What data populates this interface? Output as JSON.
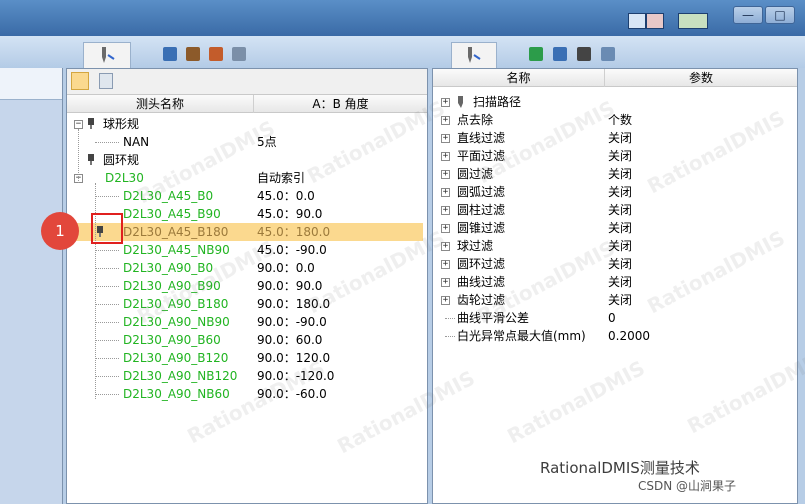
{
  "window": {
    "min_label": "—",
    "max_label": "□",
    "close_label": "✕"
  },
  "toolstrip": {
    "left_tab_icons": [
      "probe-tab-icon",
      "cube-icon",
      "probe-icon",
      "chart-icon",
      "report-icon"
    ],
    "right_tab_icons": [
      "probe-tab-icon",
      "axes-icon",
      "export-icon",
      "camera-icon",
      "scan-icon"
    ]
  },
  "left_panel": {
    "tools": [
      "probe-icon",
      "document-icon"
    ],
    "columns": [
      "测头名称",
      "A：B 角度"
    ],
    "rows": [
      {
        "name": "球形规",
        "value": "",
        "level": 0,
        "toggle": "−",
        "icon": "probe-icon",
        "color": "black"
      },
      {
        "name": "NAN",
        "value": "5点",
        "level": 1,
        "toggle": "",
        "icon": "",
        "color": "black"
      },
      {
        "name": "圆环规",
        "value": "",
        "level": 0,
        "toggle": "",
        "icon": "probe-icon",
        "color": "black"
      },
      {
        "name": "D2L30",
        "value": "自动索引",
        "level": 0,
        "toggle": "−",
        "icon": "",
        "color": "green"
      },
      {
        "name": "D2L30_A45_B0",
        "value": "45.0：0.0",
        "level": 1,
        "toggle": "",
        "icon": "",
        "color": "green"
      },
      {
        "name": "D2L30_A45_B90",
        "value": "45.0：90.0",
        "level": 1,
        "toggle": "",
        "icon": "",
        "color": "green"
      },
      {
        "name": "D2L30_A45_B180",
        "value": "45.0：180.0",
        "level": 1,
        "toggle": "",
        "icon": "probe-icon",
        "color": "green",
        "selected": true
      },
      {
        "name": "D2L30_A45_NB90",
        "value": "45.0：-90.0",
        "level": 1,
        "toggle": "",
        "icon": "",
        "color": "green"
      },
      {
        "name": "D2L30_A90_B0",
        "value": "90.0：0.0",
        "level": 1,
        "toggle": "",
        "icon": "",
        "color": "green"
      },
      {
        "name": "D2L30_A90_B90",
        "value": "90.0：90.0",
        "level": 1,
        "toggle": "",
        "icon": "",
        "color": "green"
      },
      {
        "name": "D2L30_A90_B180",
        "value": "90.0：180.0",
        "level": 1,
        "toggle": "",
        "icon": "",
        "color": "green"
      },
      {
        "name": "D2L30_A90_NB90",
        "value": "90.0：-90.0",
        "level": 1,
        "toggle": "",
        "icon": "",
        "color": "green"
      },
      {
        "name": "D2L30_A90_B60",
        "value": "90.0：60.0",
        "level": 1,
        "toggle": "",
        "icon": "",
        "color": "green"
      },
      {
        "name": "D2L30_A90_B120",
        "value": "90.0：120.0",
        "level": 1,
        "toggle": "",
        "icon": "",
        "color": "green"
      },
      {
        "name": "D2L30_A90_NB120",
        "value": "90.0：-120.0",
        "level": 1,
        "toggle": "",
        "icon": "",
        "color": "green"
      },
      {
        "name": "D2L30_A90_NB60",
        "value": "90.0：-60.0",
        "level": 1,
        "toggle": "",
        "icon": "",
        "color": "green"
      }
    ]
  },
  "right_panel": {
    "columns": [
      "名称",
      "参数"
    ],
    "rows": [
      {
        "name": "扫描路径",
        "value": "",
        "toggle": "+",
        "icon": "probe-icon"
      },
      {
        "name": "点去除",
        "value": "个数",
        "toggle": "+",
        "icon": ""
      },
      {
        "name": "直线过滤",
        "value": "关闭",
        "toggle": "+",
        "icon": ""
      },
      {
        "name": "平面过滤",
        "value": "关闭",
        "toggle": "+",
        "icon": ""
      },
      {
        "name": "圆过滤",
        "value": "关闭",
        "toggle": "+",
        "icon": ""
      },
      {
        "name": "圆弧过滤",
        "value": "关闭",
        "toggle": "+",
        "icon": ""
      },
      {
        "name": "圆柱过滤",
        "value": "关闭",
        "toggle": "+",
        "icon": ""
      },
      {
        "name": "圆锥过滤",
        "value": "关闭",
        "toggle": "+",
        "icon": ""
      },
      {
        "name": "球过滤",
        "value": "关闭",
        "toggle": "+",
        "icon": ""
      },
      {
        "name": "圆环过滤",
        "value": "关闭",
        "toggle": "+",
        "icon": ""
      },
      {
        "name": "曲线过滤",
        "value": "关闭",
        "toggle": "+",
        "icon": ""
      },
      {
        "name": "齿轮过滤",
        "value": "关闭",
        "toggle": "+",
        "icon": ""
      },
      {
        "name": "曲线平滑公差",
        "value": "0",
        "toggle": "",
        "icon": ""
      },
      {
        "name": "白光异常点最大值(mm)",
        "value": "0.2000",
        "toggle": "",
        "icon": ""
      }
    ]
  },
  "annotation": {
    "badge": "1"
  },
  "watermark": "RationalDMIS",
  "footer": {
    "brand": "RationalDMIS测量技术",
    "csdn": "CSDN @山涧果子"
  },
  "colors": {
    "selected_row": "#fbd98f",
    "green_text": "#21b421",
    "badge": "#e2473b",
    "highlight_box": "#e0201f"
  }
}
